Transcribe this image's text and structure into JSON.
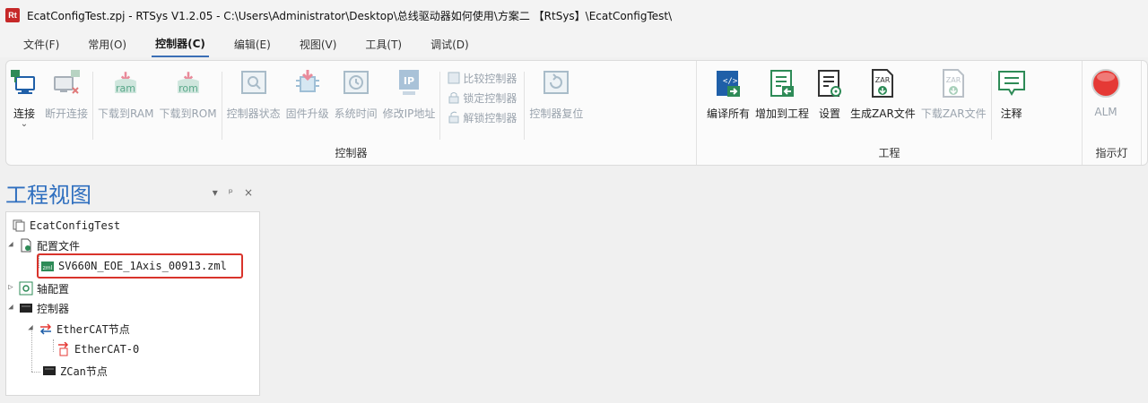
{
  "titlebar": {
    "logo": "Rt",
    "title": "EcatConfigTest.zpj - RTSys V1.2.05 - C:\\Users\\Administrator\\Desktop\\总线驱动器如何使用\\方案二 【RtSys】\\EcatConfigTest\\"
  },
  "menu": {
    "items": [
      "文件(F)",
      "常用(O)",
      "控制器(C)",
      "编辑(E)",
      "视图(V)",
      "工具(T)",
      "调试(D)"
    ],
    "active": "控制器(C)"
  },
  "ribbon": {
    "controller_group": {
      "label": "控制器",
      "tools": {
        "connect": "连接",
        "disconnect": "断开连接",
        "download_ram": "下载到RAM",
        "download_rom": "下载到ROM",
        "ctrl_status": "控制器状态",
        "firmware_upgrade": "固件升级",
        "system_time": "系统时间",
        "modify_ip": "修改IP地址",
        "compare": "比较控制器",
        "lock": "锁定控制器",
        "unlock": "解锁控制器",
        "reset": "控制器复位"
      },
      "icon_text": {
        "ram": "ram",
        "rom": "rom",
        "ip": "IP"
      }
    },
    "project_group": {
      "label": "工程",
      "tools": {
        "compile_all": "编译所有",
        "add_to_project": "增加到工程",
        "settings": "设置",
        "gen_zar": "生成ZAR文件",
        "download_zar": "下载ZAR文件",
        "comment": "注释"
      },
      "icon_text": {
        "zar": "ZAR"
      }
    },
    "indicator_group": {
      "label": "指示灯",
      "tools": {
        "alm": "ALM"
      }
    }
  },
  "panel": {
    "title": "工程视图",
    "controls": [
      "▾",
      "ᵖ",
      "×"
    ]
  },
  "tree": {
    "root": "EcatConfigTest",
    "config_folder": "配置文件",
    "config_file": "SV660N_EOE_1Axis_00913.zml",
    "axis_config": "轴配置",
    "controller": "控制器",
    "ethercat_node": "EtherCAT节点",
    "ethercat_0": "EtherCAT-0",
    "zcan_node": "ZCan节点"
  },
  "colors": {
    "accent": "#2f6fbf",
    "highlight_box": "#d9332b",
    "alm_red": "#e53935",
    "icon_green": "#2e8b57",
    "icon_blue": "#1f5fa8"
  }
}
